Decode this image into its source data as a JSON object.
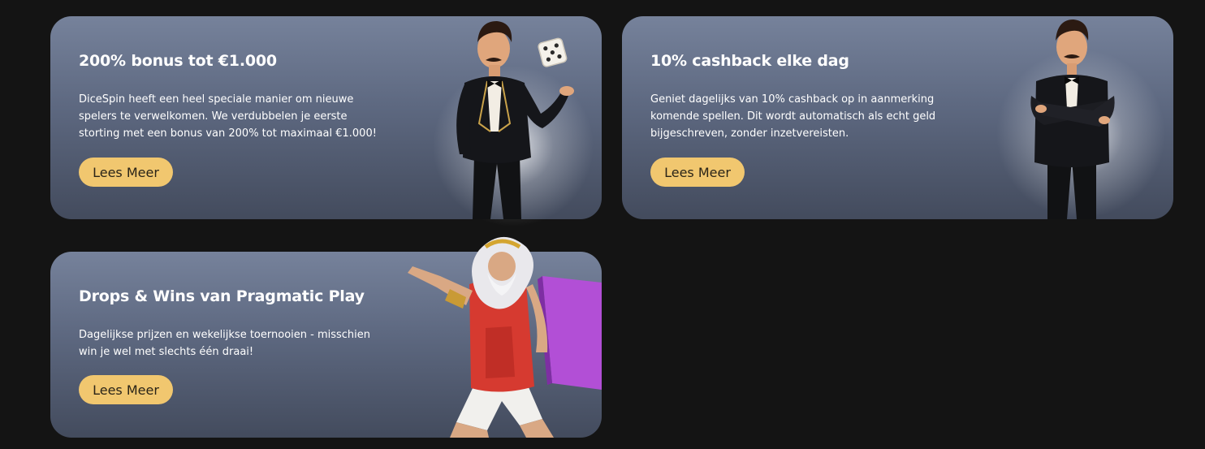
{
  "cards": [
    {
      "title": "200% bonus tot €1.000",
      "description": "DiceSpin heeft een heel speciale manier om nieuwe spelers te verwelkomen. We verdubbelen je eerste storting met een bonus van 200% tot maximaal €1.000!",
      "button_label": "Lees Meer",
      "illustration": "gentleman-with-dice-illustration"
    },
    {
      "title": "10% cashback elke dag",
      "description": "Geniet dagelijks van 10% cashback op in aanmerking komende spellen. Dit wordt automatisch als echt geld bijgeschreven, zonder inzetvereisten.",
      "button_label": "Lees Meer",
      "illustration": "gentleman-arms-crossed-illustration"
    },
    {
      "title": "Drops & Wins van Pragmatic Play",
      "description": "Dagelijkse prijzen en wekelijkse toernooien - misschien win je wel met slechts één draai!",
      "button_label": "Lees Meer",
      "illustration": "zeus-illustration"
    }
  ],
  "colors": {
    "page_background": "#141414",
    "card_gradient_top": "#76829b",
    "card_gradient_bottom": "#434b5d",
    "button_background": "#f1c76f",
    "button_text": "#2a2418",
    "text": "#ffffff"
  }
}
